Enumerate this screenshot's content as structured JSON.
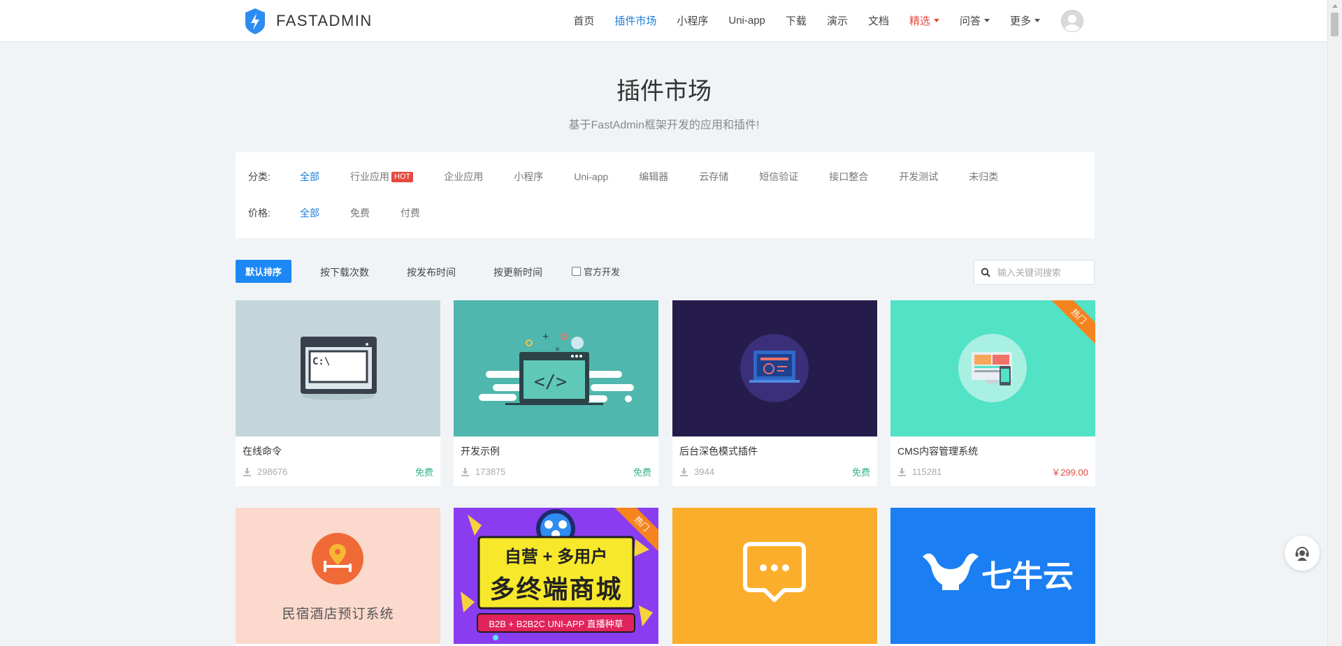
{
  "brand": {
    "name": "FASTADMIN"
  },
  "nav": {
    "items": [
      {
        "label": "首页"
      },
      {
        "label": "插件市场"
      },
      {
        "label": "小程序"
      },
      {
        "label": "Uni-app"
      },
      {
        "label": "下载"
      },
      {
        "label": "演示"
      },
      {
        "label": "文档"
      },
      {
        "label": "精选"
      },
      {
        "label": "问答"
      },
      {
        "label": "更多"
      }
    ]
  },
  "hero": {
    "title": "插件市场",
    "subtitle": "基于FastAdmin框架开发的应用和插件!"
  },
  "filters": {
    "category_label": "分类:",
    "categories": [
      "全部",
      "行业应用",
      "企业应用",
      "小程序",
      "Uni-app",
      "编辑器",
      "云存储",
      "短信验证",
      "接口整合",
      "开发测试",
      "未归类"
    ],
    "hot_badge": "HOT",
    "price_label": "价格:",
    "prices": [
      "全部",
      "免费",
      "付费"
    ]
  },
  "sort": {
    "default": "默认排序",
    "by_downloads": "按下载次数",
    "by_publish": "按发布时间",
    "by_update": "按更新时间",
    "official": "官方开发"
  },
  "search": {
    "placeholder": "输入关键词搜索"
  },
  "ribbon_label": "热门",
  "cards": [
    {
      "name": "在线命令",
      "downloads": "298676",
      "price": "免费"
    },
    {
      "name": "开发示例",
      "downloads": "173875",
      "price": "免费"
    },
    {
      "name": "后台深色模式插件",
      "downloads": "3944",
      "price": "免费"
    },
    {
      "name": "CMS内容管理系统",
      "downloads": "115281",
      "price": "￥299.00"
    }
  ],
  "cards_row2": {
    "hotel_text": "民宿酒店预订系统",
    "mall_line1": "自营 + 多用户",
    "mall_line2": "多终端商城",
    "mall_line3": "B2B + B2B2C  UNI-APP 直播种草",
    "qiniu_text": "七牛云"
  },
  "colors": {
    "accent": "#1b88f5",
    "link_active": "#1e7ed8",
    "hot": "#e6493f",
    "free": "#2eb38e",
    "ribbon": "#f5841f"
  }
}
